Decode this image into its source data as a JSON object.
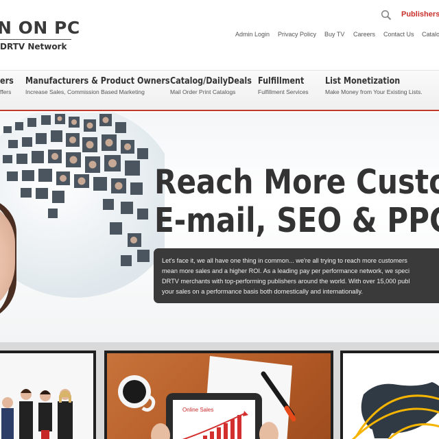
{
  "header": {
    "logo_line1": "N ON PC",
    "logo_line2": "DRTV Network",
    "publishers_link": "Publishers Lo",
    "top_nav": [
      "Admin Login",
      "Privacy Policy",
      "Buy TV",
      "Careers",
      "Contact Us",
      "Catalo"
    ]
  },
  "main_nav": [
    {
      "title": "ers",
      "sub": "ffers"
    },
    {
      "title": "Manufacturers & Product Owners",
      "sub": "Increase Sales, Commission Based Marketing"
    },
    {
      "title": "Catalog/DailyDeals",
      "sub": "Mail Order Print Catalogs"
    },
    {
      "title": "Fulfillment",
      "sub": "Fulfillment Services"
    },
    {
      "title": "List Monetization",
      "sub": "Make Money from Your Existing Lists."
    }
  ],
  "hero": {
    "title_line1": "Reach More Custom",
    "title_line2": "E-mail, SEO & PPC",
    "body_lines": [
      "Let's face it, we all have one thing in common... we're all trying to reach more customers",
      "mean more sales and a higher ROI. As a leading pay per performance network, we speci",
      "DRTV merchants with top-performing publishers around the world. With over 15,000 publ",
      "your sales on a performance basis both domestically and internationally."
    ]
  },
  "panels": {
    "online_sales_label": "Online Sales"
  },
  "colors": {
    "accent_red": "#c0392b",
    "hero_box": "#3a3a3a",
    "panel_frame": "#1f1f1f"
  }
}
